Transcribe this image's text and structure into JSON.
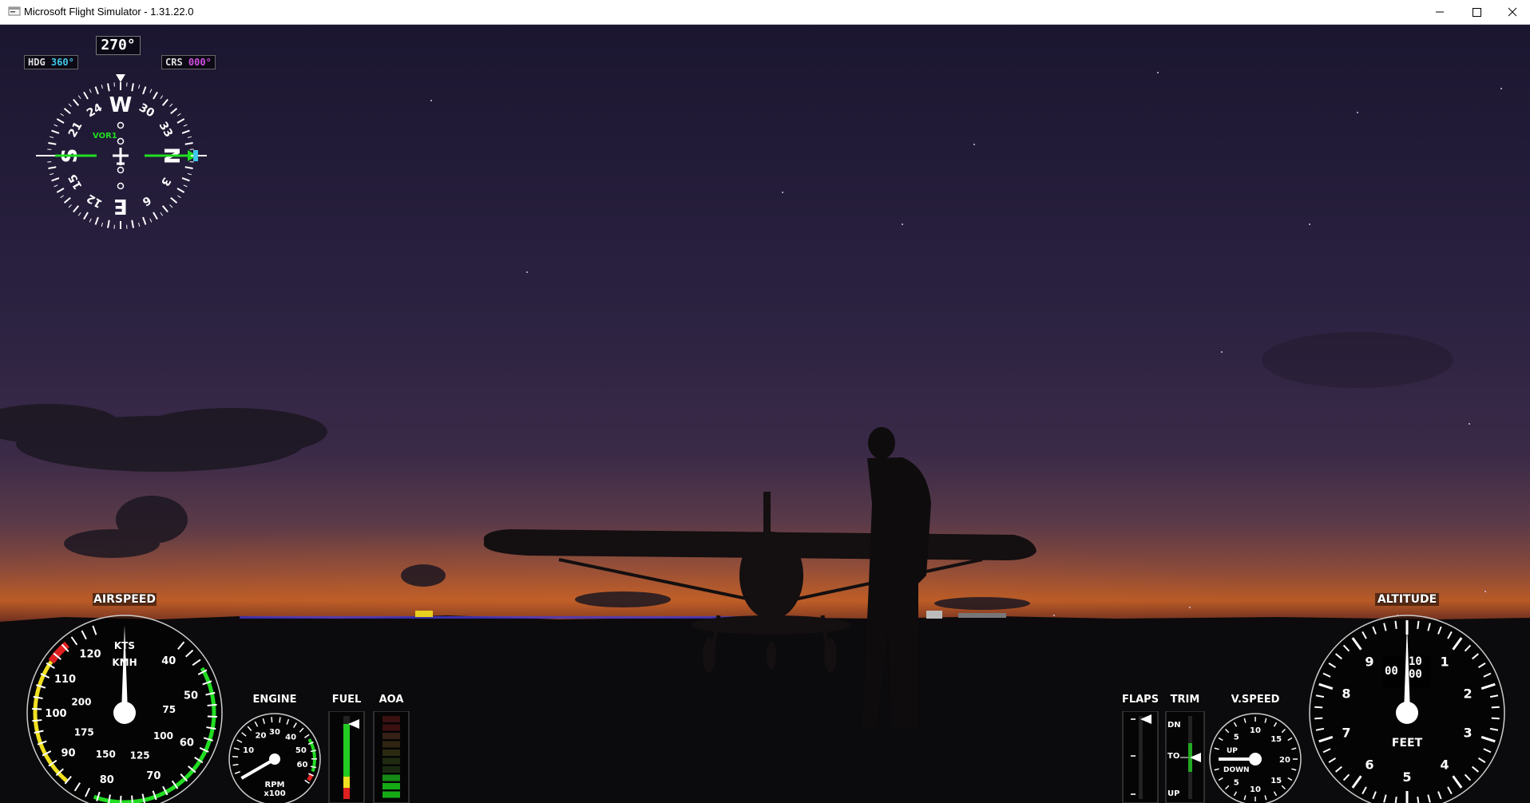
{
  "window": {
    "title": "Microsoft Flight Simulator - 1.31.22.0",
    "minimize_glyph": "—",
    "maximize_glyph": "☐",
    "close_glyph": "✕"
  },
  "heading_indicator": {
    "heading_readout": "270°",
    "hdg_label": "HDG",
    "hdg_value": "360°",
    "crs_label": "CRS",
    "crs_value": "000°",
    "nav_source": "VOR1",
    "cardinals": {
      "top": "W",
      "bottom": "E",
      "left": "S",
      "right": "N"
    },
    "numbers": [
      "24",
      "30",
      "33",
      "3",
      "6",
      "12",
      "15",
      "21"
    ],
    "colors": {
      "hdg": "#3fc8e8",
      "crs": "#d050e0",
      "course_needle": "#22dd22",
      "bug": "#3fc8e8"
    }
  },
  "airspeed": {
    "label": "AIRSPEED",
    "unit_knots": "KTS",
    "unit_kmh": "KMH",
    "knots_labels": [
      "40",
      "50",
      "60",
      "70",
      "80",
      "90",
      "100",
      "110",
      "120"
    ],
    "kmh_labels": [
      "75",
      "100",
      "125",
      "150",
      "175",
      "200"
    ],
    "colors": {
      "green_arc": "#22dd22",
      "yellow_arc": "#f0e020",
      "redline": "#e02020"
    }
  },
  "engine": {
    "label": "ENGINE",
    "unit": "RPM",
    "multiplier": "x100",
    "scale_labels": [
      "10",
      "20",
      "30",
      "40",
      "50",
      "60"
    ]
  },
  "fuel": {
    "label": "FUEL"
  },
  "aoa": {
    "label": "AOA"
  },
  "flaps": {
    "label": "FLAPS"
  },
  "trim": {
    "label": "TRIM",
    "dn": "DN",
    "to": "TO",
    "up": "UP"
  },
  "vspeed": {
    "label": "V.SPEED",
    "up_label": "UP",
    "down_label": "DOWN",
    "scale_labels": [
      "5",
      "10",
      "15",
      "20",
      "15",
      "10",
      "5"
    ]
  },
  "altitude": {
    "label": "ALTITUDE",
    "unit": "FEET",
    "digits": [
      "0",
      "1",
      "2",
      "3",
      "4",
      "5",
      "6",
      "7",
      "8",
      "9"
    ],
    "readout_hundreds": "00",
    "readout_thousands": "10",
    "readout_tenthousands": "00"
  }
}
